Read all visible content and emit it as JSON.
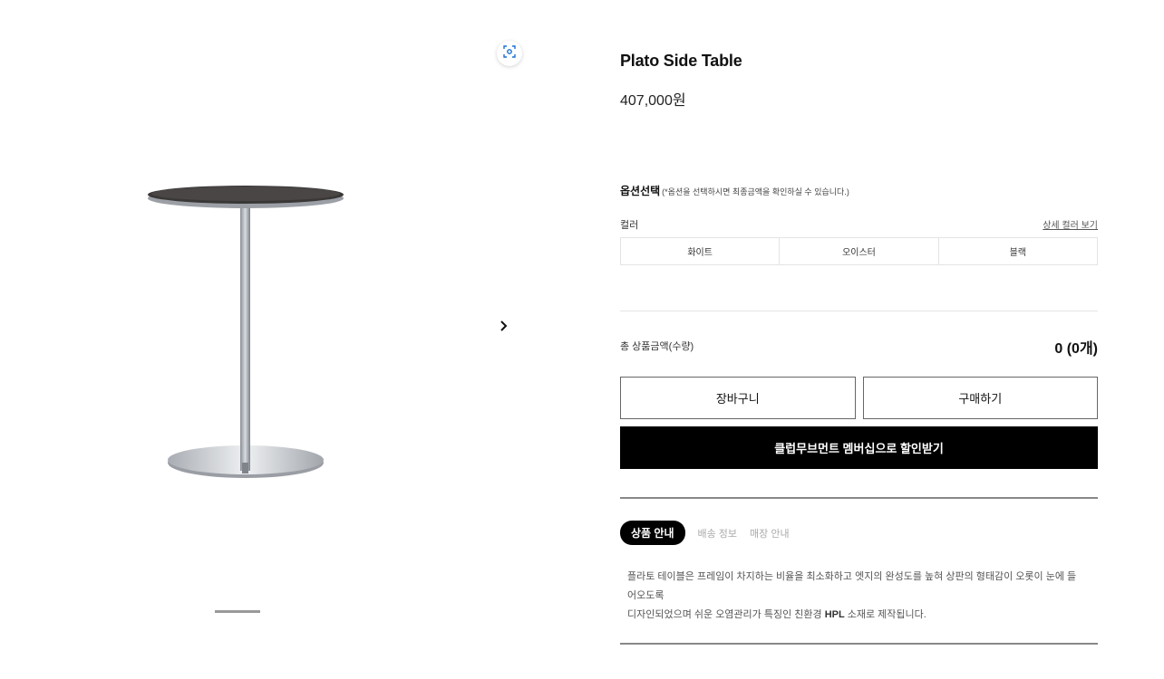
{
  "product": {
    "title": "Plato Side Table",
    "price": "407,000원"
  },
  "gallery": {
    "zoom_icon": "zoom-icon",
    "next_icon": "chevron-right-icon",
    "slide_index": 1
  },
  "options": {
    "heading": "옵션선택",
    "note": "(*옵션을 선택하시면 최종금액을 확인하실 수 있습니다.)",
    "color_label": "컬러",
    "color_detail_link": "상세 컬러 보기",
    "colors": [
      "화이트",
      "오이스터",
      "블랙"
    ]
  },
  "total": {
    "label": "총 상품금액(수량)",
    "value": "0 (0개)"
  },
  "buttons": {
    "cart": "장바구니",
    "buy": "구매하기",
    "membership": "클럽무브먼트 멤버십으로 할인받기"
  },
  "tabs": {
    "active": "상품 안내",
    "shipping": "배송 정보",
    "store": "매장 안내"
  },
  "description": {
    "line1": "플라토 테이블은 프레임이 차지하는 비율을 최소화하고 엣지의 완성도를 높혀 상판의 형태감이 오롯이 눈에 들어오도록",
    "line2_pre": "디자인되었으며 쉬운 오염관리가 특징인 친환경 ",
    "line2_bold": "HPL",
    "line2_post": " 소재로 제작됩니다."
  },
  "colors": {
    "accent": "#000000",
    "zoom_icon": "#1a6fd6"
  }
}
